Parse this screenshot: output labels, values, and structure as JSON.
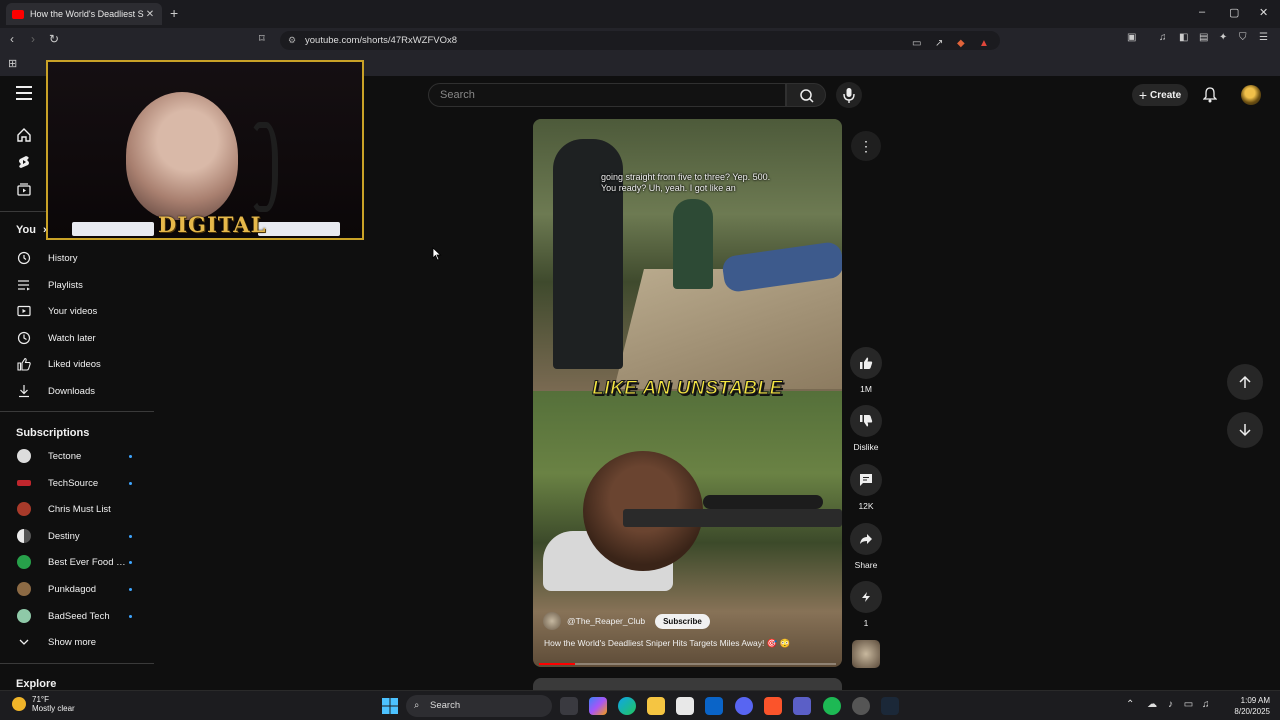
{
  "browser": {
    "tab_title": "How the World's Deadliest Sn",
    "url": "youtube.com/shorts/47RxWZFVOx8",
    "new_tab_symbol": "+",
    "close_symbol": "✕"
  },
  "masthead": {
    "search_placeholder": "Search",
    "create_label": "Create"
  },
  "sidebar": {
    "you_label": "You",
    "you_chevron": "›",
    "you_items": [
      {
        "label": "History",
        "icon": "history-icon"
      },
      {
        "label": "Playlists",
        "icon": "playlists-icon"
      },
      {
        "label": "Your videos",
        "icon": "your-videos-icon"
      },
      {
        "label": "Watch later",
        "icon": "watch-later-icon"
      },
      {
        "label": "Liked videos",
        "icon": "liked-videos-icon"
      },
      {
        "label": "Downloads",
        "icon": "downloads-icon"
      }
    ],
    "subscriptions_title": "Subscriptions",
    "subscriptions": [
      {
        "label": "Tectone",
        "color": "#dcdcdc",
        "live_dot": true
      },
      {
        "label": "TechSource",
        "color": "#c0262d",
        "live_dot": true
      },
      {
        "label": "Chris Must List",
        "color": "#a83a2a",
        "live_dot": false
      },
      {
        "label": "Destiny",
        "color": "#ebebeb",
        "live_dot": true
      },
      {
        "label": "Best Ever Food R...",
        "color": "#27a04a",
        "live_dot": true
      },
      {
        "label": "Punkdagod",
        "color": "#8c6a44",
        "live_dot": true
      },
      {
        "label": "BadSeed Tech",
        "color": "#8fc9a8",
        "live_dot": true
      }
    ],
    "show_more_label": "Show more",
    "explore_title": "Explore"
  },
  "webcam": {
    "logo_text": "DIGITAL"
  },
  "short": {
    "subtitle_text": "going straight from five to three? Yep. 500. You ready? Uh, yeah. I got like an",
    "caption_text": "LIKE AN UNSTABLE",
    "channel_handle": "@The_Reaper_Club",
    "subscribe_label": "Subscribe",
    "title": "How the World's Deadliest Sniper Hits Targets Miles Away! 🎯 😳",
    "progress_fraction": 0.12
  },
  "actions": {
    "like_count": "1M",
    "dislike_label": "Dislike",
    "comment_count": "12K",
    "share_label": "Share",
    "remix_count": "1",
    "more_symbol": "⋮"
  },
  "taskbar": {
    "temperature": "71°F",
    "condition": "Mostly clear",
    "search_label": "Search",
    "time": "1:09 AM",
    "date": "8/20/2025"
  }
}
